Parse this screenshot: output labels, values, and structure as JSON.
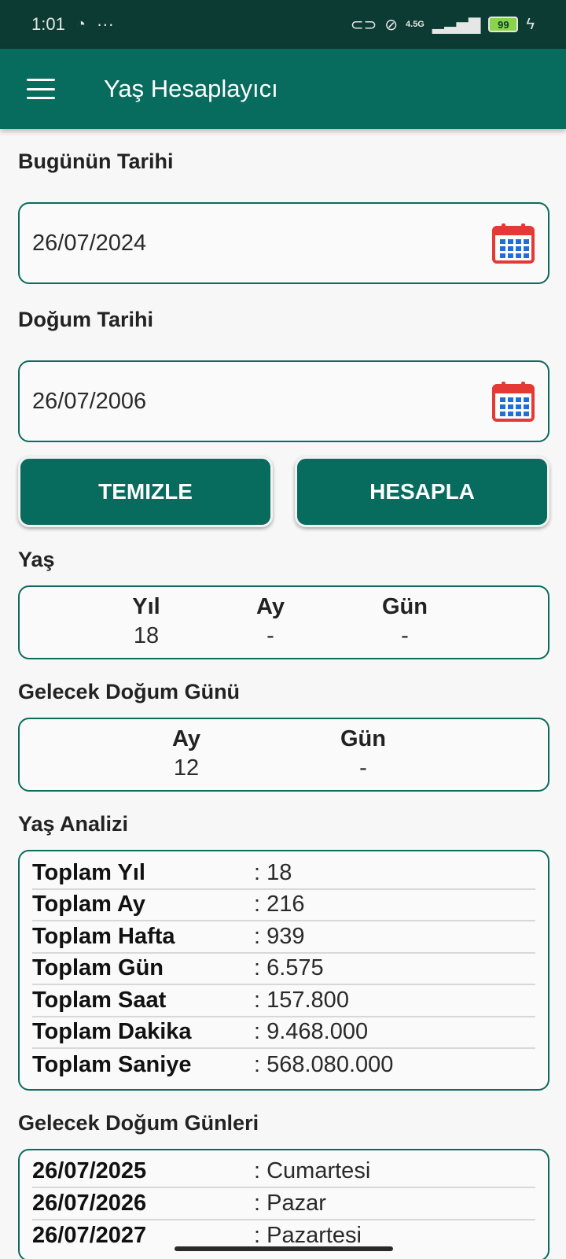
{
  "status_bar": {
    "time": "1:01",
    "more": "···",
    "network": "4.5G",
    "battery": "99"
  },
  "app_bar": {
    "title": "Yaş Hesaplayıcı"
  },
  "today": {
    "label": "Bugünün Tarihi",
    "value": "26/07/2024"
  },
  "birth": {
    "label": "Doğum Tarihi",
    "value": "26/07/2006"
  },
  "buttons": {
    "clear": "TEMIZLE",
    "calculate": "HESAPLA"
  },
  "age": {
    "label": "Yaş",
    "year_header": "Yıl",
    "year_value": "18",
    "month_header": "Ay",
    "month_value": "-",
    "day_header": "Gün",
    "day_value": "-"
  },
  "next_birthday": {
    "label": "Gelecek Doğum Günü",
    "month_header": "Ay",
    "month_value": "12",
    "day_header": "Gün",
    "day_value": "-"
  },
  "analysis": {
    "label": "Yaş Analizi",
    "rows": [
      {
        "key": "Toplam Yıl",
        "value": ": 18"
      },
      {
        "key": "Toplam Ay",
        "value": ": 216"
      },
      {
        "key": "Toplam Hafta",
        "value": ": 939"
      },
      {
        "key": "Toplam Gün",
        "value": ": 6.575"
      },
      {
        "key": "Toplam Saat",
        "value": ": 157.800"
      },
      {
        "key": "Toplam Dakika",
        "value": ": 9.468.000"
      },
      {
        "key": "Toplam Saniye",
        "value": ": 568.080.000"
      }
    ]
  },
  "upcoming": {
    "label": "Gelecek Doğum Günleri",
    "rows": [
      {
        "date": "26/07/2025",
        "day": ": Cumartesi"
      },
      {
        "date": "26/07/2026",
        "day": ": Pazar"
      },
      {
        "date": "26/07/2027",
        "day": ": Pazartesi"
      }
    ]
  },
  "colors": {
    "primary": "#076b5e",
    "status_bar": "#0b3b33",
    "calendar_icon": "#e53935",
    "calendar_grid": "#1e6fd9"
  }
}
